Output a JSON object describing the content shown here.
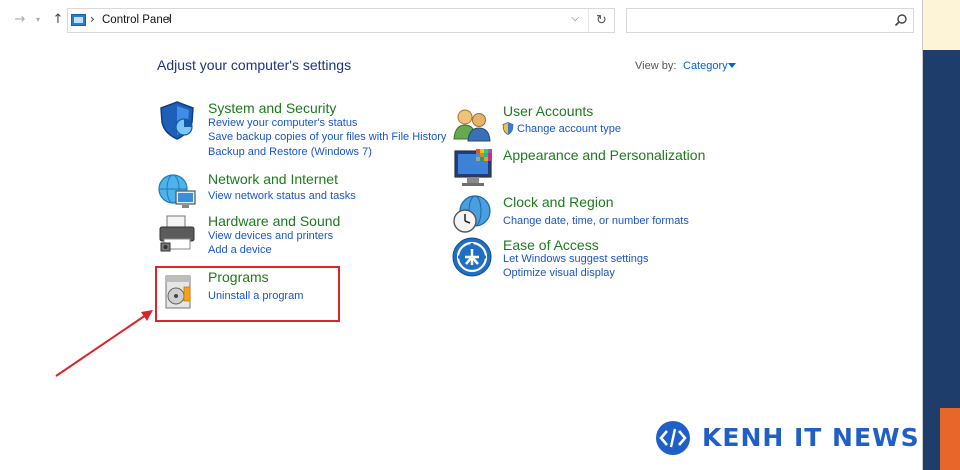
{
  "nav": {
    "back_icon": "back-arrow-icon",
    "forward_icon": "forward-arrow-icon",
    "up_icon": "up-arrow-icon",
    "address": "Control Panel",
    "search_placeholder": ""
  },
  "main": {
    "heading": "Adjust your computer's settings",
    "view_by_label": "View by:",
    "view_by_value": "Category"
  },
  "categories_left": [
    {
      "title": "System and Security",
      "links": [
        "Review your computer's status",
        "Save backup copies of your files with File History",
        "Backup and Restore (Windows 7)"
      ]
    },
    {
      "title": "Network and Internet",
      "links": [
        "View network status and tasks"
      ]
    },
    {
      "title": "Hardware and Sound",
      "links": [
        "View devices and printers",
        "Add a device"
      ]
    },
    {
      "title": "Programs",
      "links": [
        "Uninstall a program"
      ]
    }
  ],
  "categories_right": [
    {
      "title": "User Accounts",
      "links": [
        "Change account type"
      ]
    },
    {
      "title": "Appearance and Personalization",
      "links": []
    },
    {
      "title": "Clock and Region",
      "links": [
        "Change date, time, or number formats"
      ]
    },
    {
      "title": "Ease of Access",
      "links": [
        "Let Windows suggest settings",
        "Optimize visual display"
      ]
    }
  ],
  "watermark": {
    "text": "KENH IT NEWS"
  },
  "colors": {
    "title_green": "#1e7a1e",
    "link_blue": "#1a56c8",
    "heading_blue": "#1e3287",
    "highlight_red": "#d9262a"
  }
}
